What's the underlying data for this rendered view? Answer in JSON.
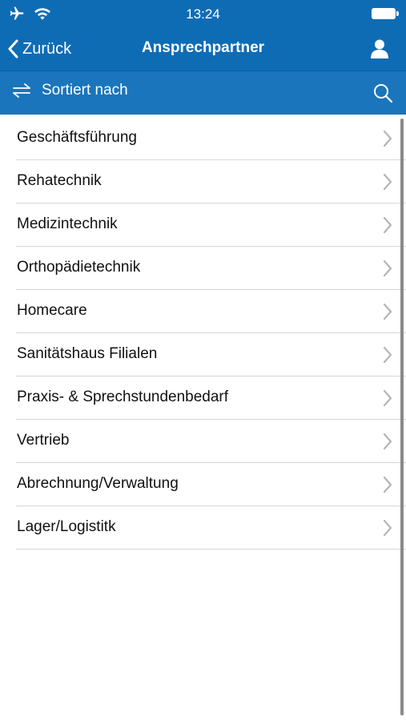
{
  "status_bar": {
    "time": "13:24",
    "icons": [
      "airplane-icon",
      "wifi-icon",
      "battery-icon"
    ]
  },
  "nav_bar": {
    "back_label": "Zurück",
    "title": "Ansprechpartner",
    "right_icon": "profile-icon"
  },
  "sort_bar": {
    "label": "Sortiert nach",
    "left_icon": "sort-arrows-icon",
    "right_icon": "search-icon"
  },
  "list": {
    "items": [
      {
        "label": "Geschäftsführung"
      },
      {
        "label": "Rehatechnik"
      },
      {
        "label": "Medizintechnik"
      },
      {
        "label": "Orthopädietechnik"
      },
      {
        "label": "Homecare"
      },
      {
        "label": "Sanitätshaus Filialen"
      },
      {
        "label": "Praxis- & Sprechstundenbedarf"
      },
      {
        "label": "Vertrieb"
      },
      {
        "label": "Abrechnung/Verwaltung"
      },
      {
        "label": "Lager/Logistitk"
      }
    ]
  },
  "colors": {
    "header": "#0e6cb5",
    "sort_bar": "#1a75bc",
    "divider": "#d6d6d6",
    "chevron": "#b5b5b5"
  }
}
